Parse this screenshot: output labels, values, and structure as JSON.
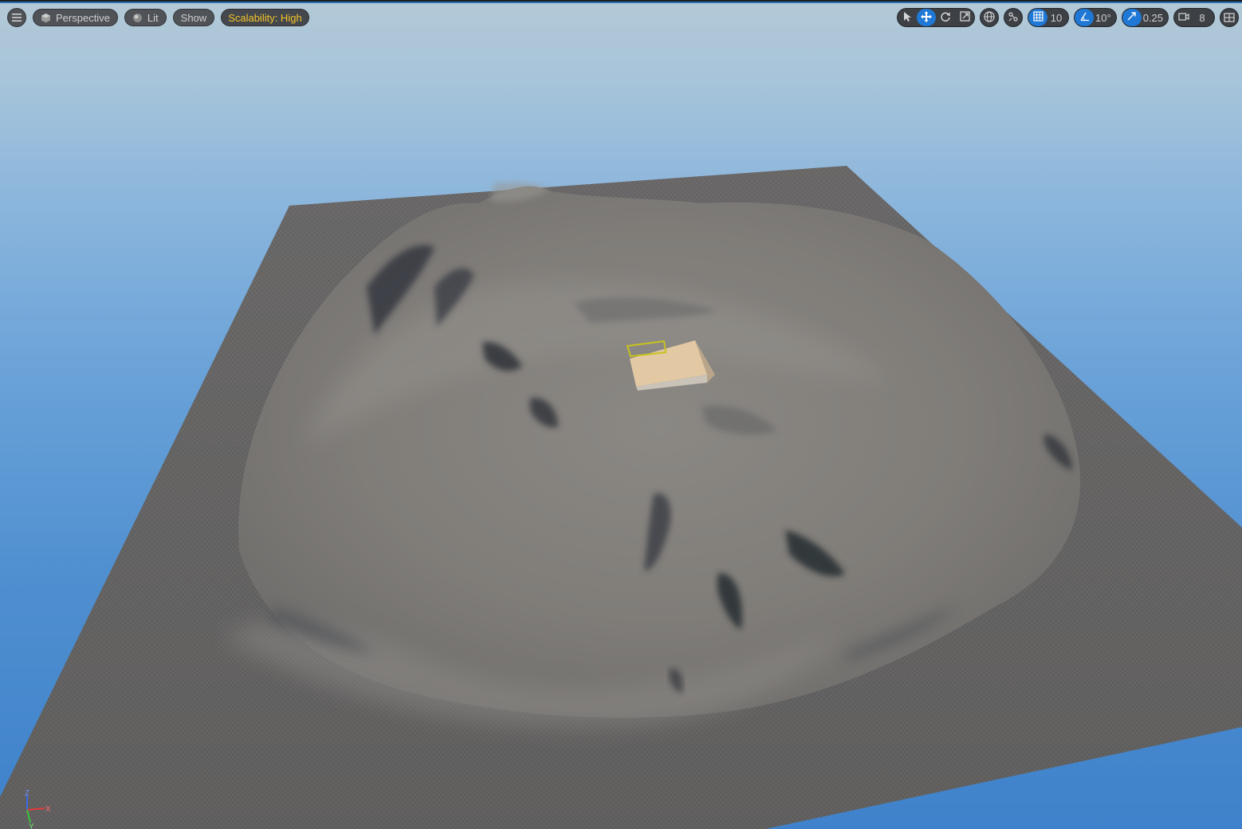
{
  "viewport": {
    "menu_icon": "hamburger-menu-icon",
    "perspective_label": "Perspective",
    "lit_label": "Lit",
    "show_label": "Show",
    "scalability_label": "Scalability: High"
  },
  "transform_tools": {
    "select_icon": "cursor-arrow-icon",
    "translate_icon": "move-arrows-icon",
    "rotate_icon": "rotate-icon",
    "scale_icon": "scale-icon",
    "active_tool": "translate"
  },
  "snapping": {
    "world_local_icon": "globe-icon",
    "surface_snap_icon": "surface-snap-icon",
    "grid_snap_value": "10",
    "rotation_snap_value": "10°",
    "scale_snap_value": "0.25",
    "camera_speed_value": "8",
    "layout_icon": "viewport-layout-icon"
  },
  "colors": {
    "accent_blue": "#1f78d6",
    "scalability_yellow": "#f3c52a",
    "selection_yellow": "#c7c21e",
    "axis_x": "#e53a3a",
    "axis_y": "#3ac43a",
    "axis_z": "#3a6ae5"
  },
  "gizmo": {
    "x_label": "X",
    "y_label": "Y",
    "z_label": "Z"
  }
}
